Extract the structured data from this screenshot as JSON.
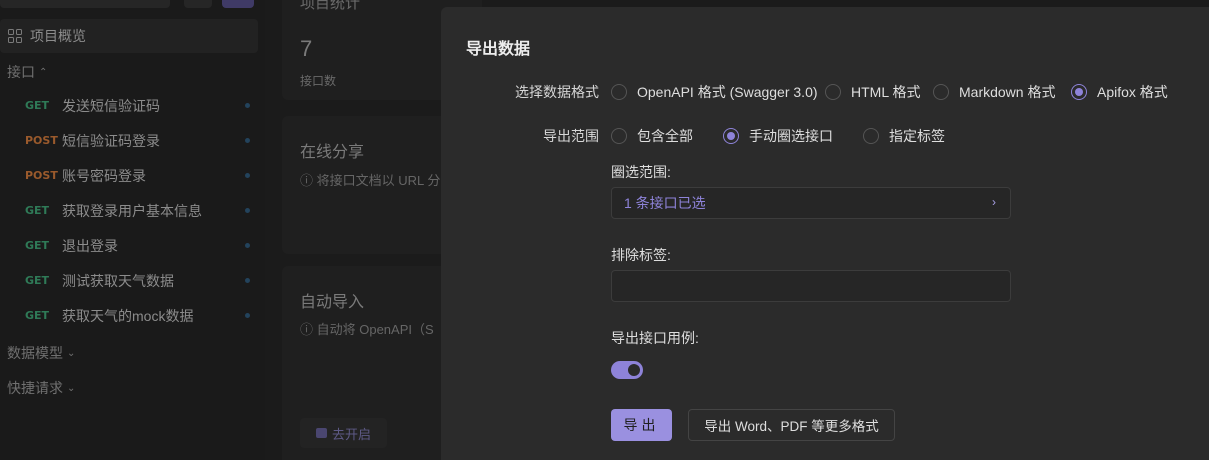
{
  "sidebar": {
    "overview_label": "项目概览",
    "api_section": "接口",
    "apis": [
      {
        "method": "GET",
        "label": "发送短信验证码"
      },
      {
        "method": "POST",
        "label": "短信验证码登录"
      },
      {
        "method": "POST",
        "label": "账号密码登录"
      },
      {
        "method": "GET",
        "label": "获取登录用户基本信息"
      },
      {
        "method": "GET",
        "label": "退出登录"
      },
      {
        "method": "GET",
        "label": "测试获取天气数据"
      },
      {
        "method": "GET",
        "label": "获取天气的mock数据"
      }
    ],
    "models_section": "数据模型",
    "quick_section": "快捷请求"
  },
  "main": {
    "stats_title": "项目统计",
    "stats_number": "7",
    "stats_label": "接口数",
    "share_title": "在线分享",
    "share_desc": "ⓘ 将接口文档以 URL 分",
    "auto_title": "自动导入",
    "auto_desc": "ⓘ 自动将 OpenAPI（S",
    "enable_label": "去开启"
  },
  "modal": {
    "title": "导出数据",
    "format_label": "选择数据格式",
    "formats": [
      "OpenAPI 格式 (Swagger 3.0)",
      "HTML 格式",
      "Markdown 格式",
      "Apifox 格式"
    ],
    "selected_format": "Apifox 格式",
    "scope_label": "导出范围",
    "scopes": [
      "包含全部",
      "手动圈选接口",
      "指定标签"
    ],
    "selected_scope": "手动圈选接口",
    "range_label": "圈选范围:",
    "range_value": "1 条接口已选",
    "exclude_label": "排除标签:",
    "exclude_value": "",
    "examples_label": "导出接口用例:",
    "examples_enabled": true,
    "export_button": "导出",
    "more_button": "导出 Word、PDF 等更多格式"
  },
  "colors": {
    "accent": "#8e83d9",
    "get": "#2f7a57",
    "post": "#9a5a2c"
  }
}
